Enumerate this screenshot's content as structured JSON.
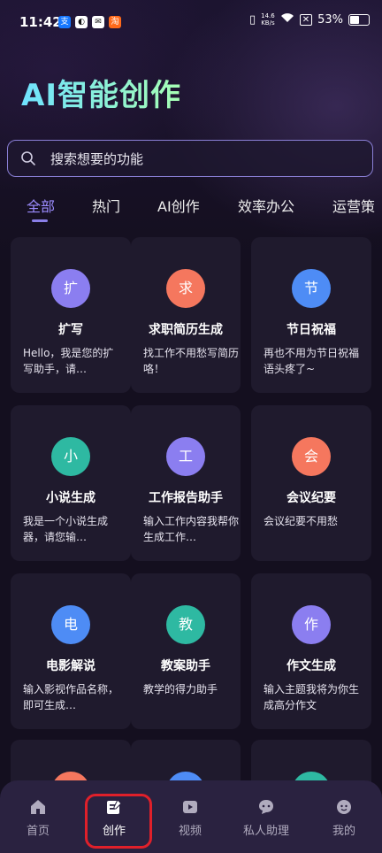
{
  "status": {
    "time": "11:42",
    "netspeed_value": "14.6",
    "netspeed_unit": "KB/s",
    "battery": "53%",
    "notif_icons": [
      "alipay-icon",
      "app-icon",
      "mail-icon",
      "app-store-icon"
    ]
  },
  "title": "AI智能创作",
  "search": {
    "placeholder": "搜索想要的功能"
  },
  "tabs": [
    "全部",
    "热门",
    "AI创作",
    "效率办公",
    "运营策"
  ],
  "cards": [
    {
      "icon": "扩",
      "title": "扩写",
      "desc": "Hello，我是您的扩写助手，请…",
      "color": "#8b7ef0"
    },
    {
      "icon": "求",
      "title": "求职简历生成",
      "desc": "找工作不用愁写简历咯！",
      "color": "#f5775e"
    },
    {
      "icon": "节",
      "title": "节日祝福",
      "desc": "再也不用为节日祝福语头疼了~",
      "color": "#4e8cf5"
    },
    {
      "icon": "小",
      "title": "小说生成",
      "desc": "我是一个小说生成器，请您输…",
      "color": "#2eb9a2"
    },
    {
      "icon": "工",
      "title": "工作报告助手",
      "desc": "输入工作内容我帮你生成工作…",
      "color": "#8b7ef0"
    },
    {
      "icon": "会",
      "title": "会议纪要",
      "desc": "会议纪要不用愁",
      "color": "#f5775e"
    },
    {
      "icon": "电",
      "title": "电影解说",
      "desc": "输入影视作品名称，即可生成…",
      "color": "#4e8cf5"
    },
    {
      "icon": "教",
      "title": "教案助手",
      "desc": "教学的得力助手",
      "color": "#2eb9a2"
    },
    {
      "icon": "作",
      "title": "作文生成",
      "desc": "输入主题我将为你生成高分作文",
      "color": "#8b7ef0"
    },
    {
      "icon": "",
      "title": "",
      "desc": "",
      "color": "#f5775e"
    },
    {
      "icon": "",
      "title": "",
      "desc": "",
      "color": "#4e8cf5"
    },
    {
      "icon": "",
      "title": "",
      "desc": "",
      "color": "#2eb9a2"
    }
  ],
  "nav": [
    {
      "label": "首页",
      "icon": "home-icon"
    },
    {
      "label": "创作",
      "icon": "create-icon"
    },
    {
      "label": "视频",
      "icon": "video-icon"
    },
    {
      "label": "私人助理",
      "icon": "assistant-icon"
    },
    {
      "label": "我的",
      "icon": "profile-icon"
    }
  ],
  "colors": {
    "accent": "#8a7fe8",
    "highlight_box": "#e0202a"
  }
}
